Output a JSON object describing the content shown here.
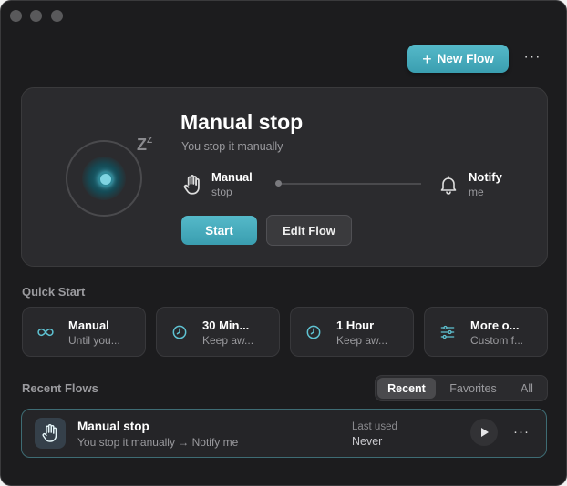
{
  "toolbar": {
    "new_flow_label": "New Flow",
    "more_label": "···"
  },
  "hero": {
    "title": "Manual stop",
    "subtitle": "You stop it manually",
    "trigger": {
      "name": "Manual",
      "desc": "stop",
      "icon": "hand-icon"
    },
    "action": {
      "name": "Notify",
      "desc": "me",
      "icon": "bell-icon"
    },
    "zz": "Z",
    "zz_small": "Z",
    "start_label": "Start",
    "edit_label": "Edit Flow"
  },
  "quick_start": {
    "label": "Quick Start",
    "items": [
      {
        "title": "Manual",
        "desc": "Until you...",
        "icon": "infinity-icon"
      },
      {
        "title": "30 Min...",
        "desc": "Keep aw...",
        "icon": "clock-icon"
      },
      {
        "title": "1 Hour",
        "desc": "Keep aw...",
        "icon": "clock-icon"
      },
      {
        "title": "More o...",
        "desc": "Custom f...",
        "icon": "sliders-icon"
      }
    ]
  },
  "recent_flows": {
    "label": "Recent Flows",
    "tabs": [
      "Recent",
      "Favorites",
      "All"
    ],
    "active_tab": "Recent",
    "items": [
      {
        "title": "Manual stop",
        "subtitle": "You stop it manually → Notify me",
        "last_used_label": "Last used",
        "last_used_value": "Never",
        "more_label": "···"
      }
    ]
  },
  "colors": {
    "accent": "#4aacbd",
    "background": "#1c1c1e",
    "card": "#2b2b2e"
  }
}
